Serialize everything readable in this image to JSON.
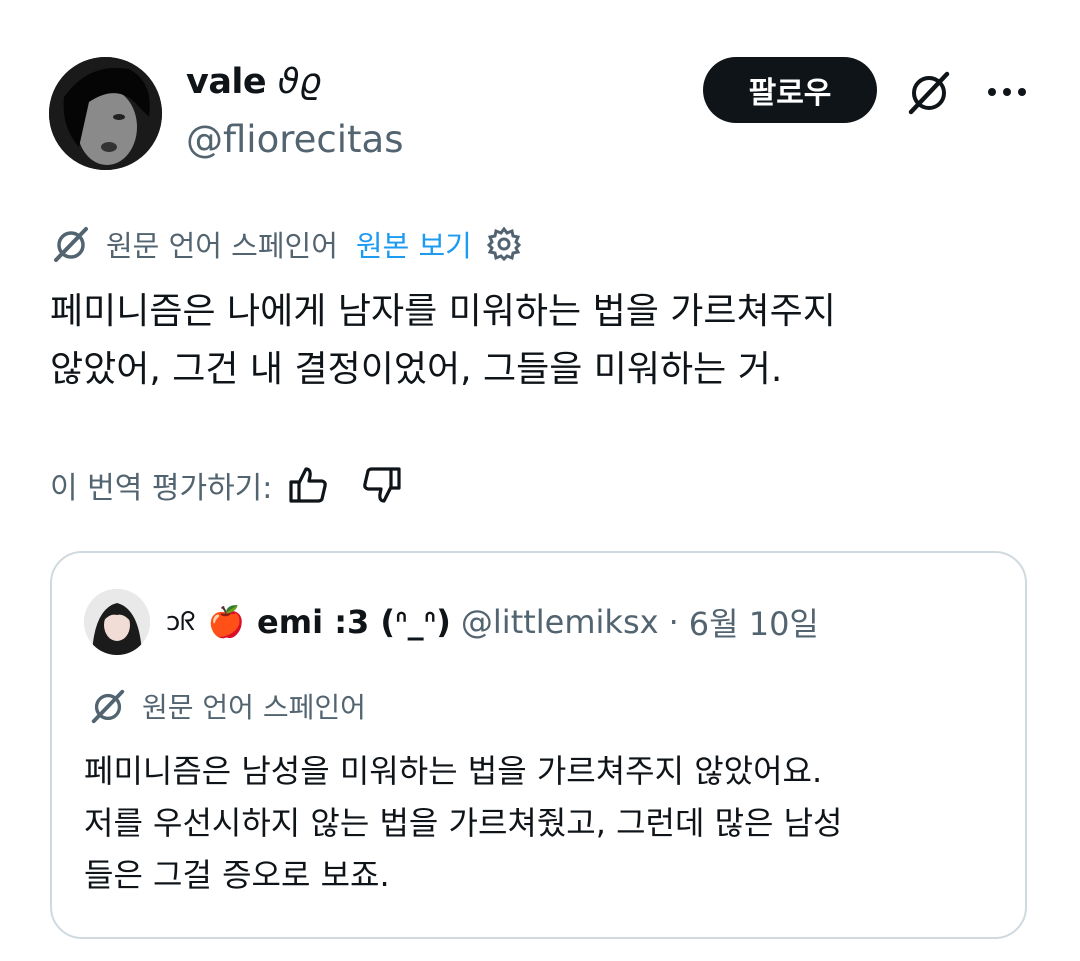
{
  "author": {
    "name": "vale",
    "name_deco": "ϑϱ",
    "handle": "@fliorecitas"
  },
  "actions": {
    "follow_label": "팔로우",
    "grok_icon": "slashed-circle-icon",
    "more_icon": "more-dots-icon"
  },
  "translation": {
    "source_language": "원문 언어 스페인어",
    "show_original": "원본 보기",
    "settings_icon": "gear-icon"
  },
  "tweet": {
    "lines": [
      "페미니즘은 나에게 남자를 미워하는 법을 가르쳐주지",
      "않았어, 그건 내 결정이었어, 그들을 미워하는 거."
    ]
  },
  "rating": {
    "label": "이 번역 평가하기:"
  },
  "quote": {
    "deco": "ɔᖇ",
    "emoji": "🍎",
    "name": "emi :3 (ᐢ_ᐢ)",
    "handle": "@littlemiksx",
    "separator": "·",
    "date": "6월 10일",
    "source_language": "원문 언어 스페인어",
    "lines": [
      "페미니즘은 남성을 미워하는 법을 가르쳐주지 않았어요.",
      "저를 우선시하지 않는 법을 가르쳐줬고, 그런데 많은 남성",
      "들은 그걸 증오로 보죠."
    ]
  },
  "colors": {
    "text": "#0f1419",
    "secondary": "#536471",
    "link": "#1d9bf0",
    "border": "#cfd9de",
    "button_bg": "#0f1419"
  }
}
